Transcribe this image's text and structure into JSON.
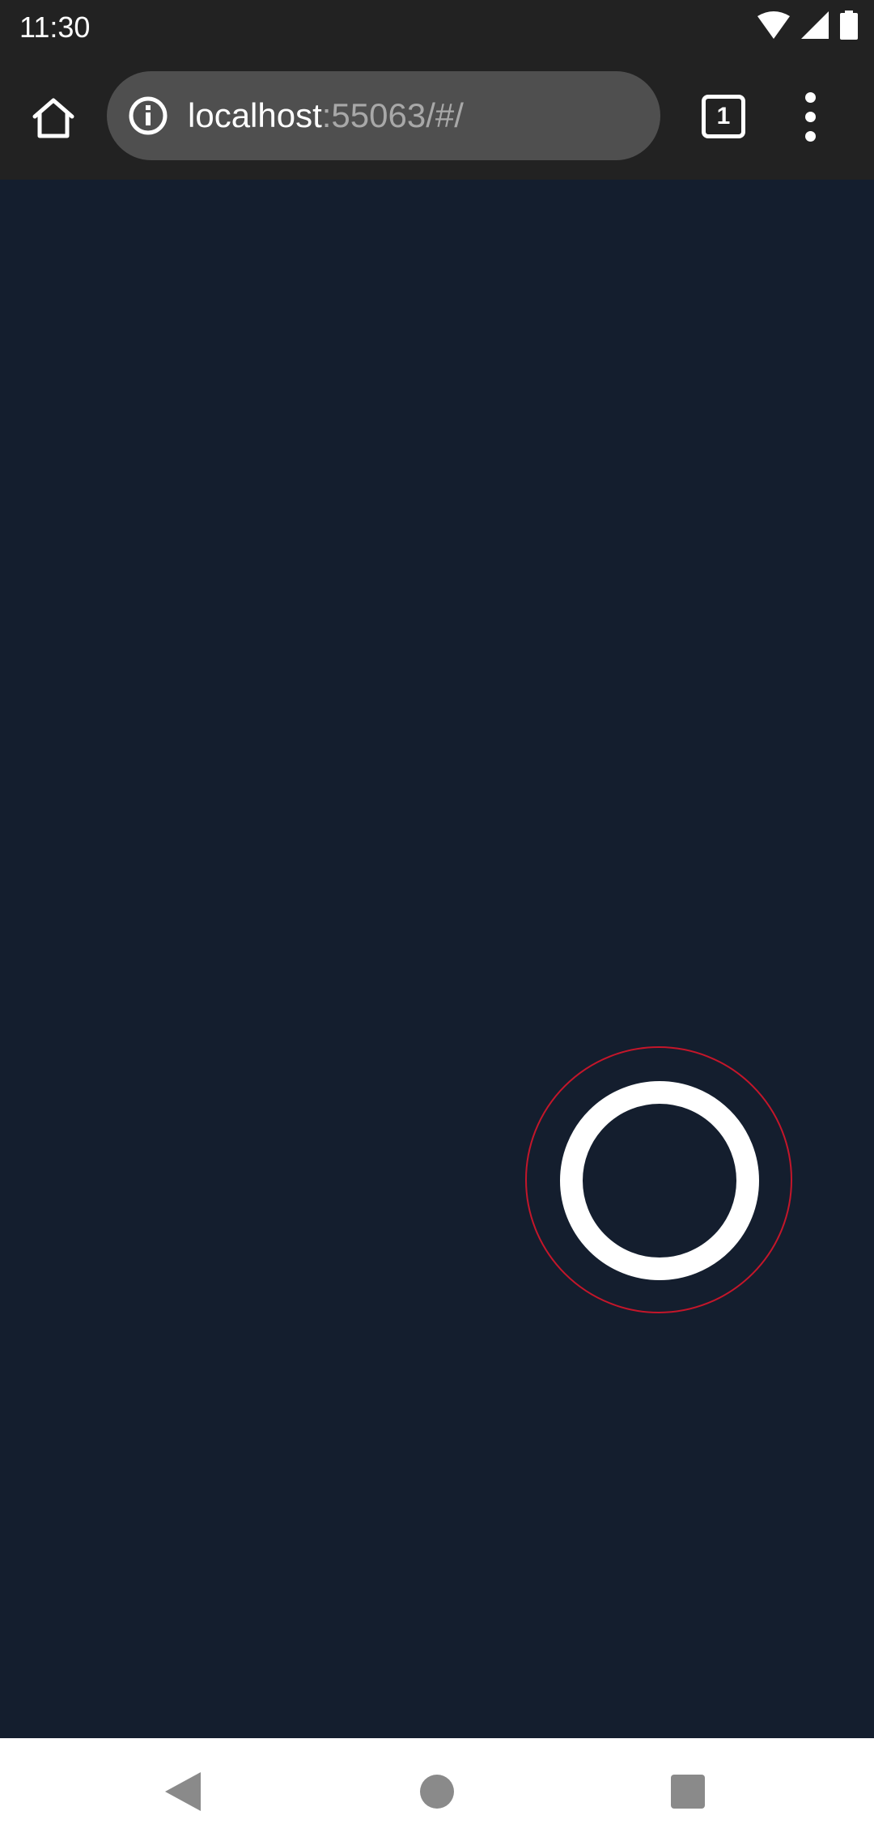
{
  "status_bar": {
    "time": "11:30",
    "icons": [
      "wifi-icon",
      "cell-signal-icon",
      "battery-icon"
    ]
  },
  "browser": {
    "url_host": "localhost",
    "url_rest": ":55063/#/",
    "tab_count": "1",
    "icons": [
      "home-icon",
      "info-icon",
      "tabs-icon",
      "more-vert-icon"
    ]
  },
  "colors": {
    "toolbar": "#222222",
    "url_bar": "#4f4f4f",
    "page_background": "#141e2e",
    "ring": "#ffffff",
    "outline": "#c4162a",
    "nav_bar": "#ffffff",
    "nav_icons": "#8a8a8a"
  },
  "nav_bar": {
    "icons": [
      "back-icon",
      "home-circle-icon",
      "recents-icon"
    ]
  }
}
